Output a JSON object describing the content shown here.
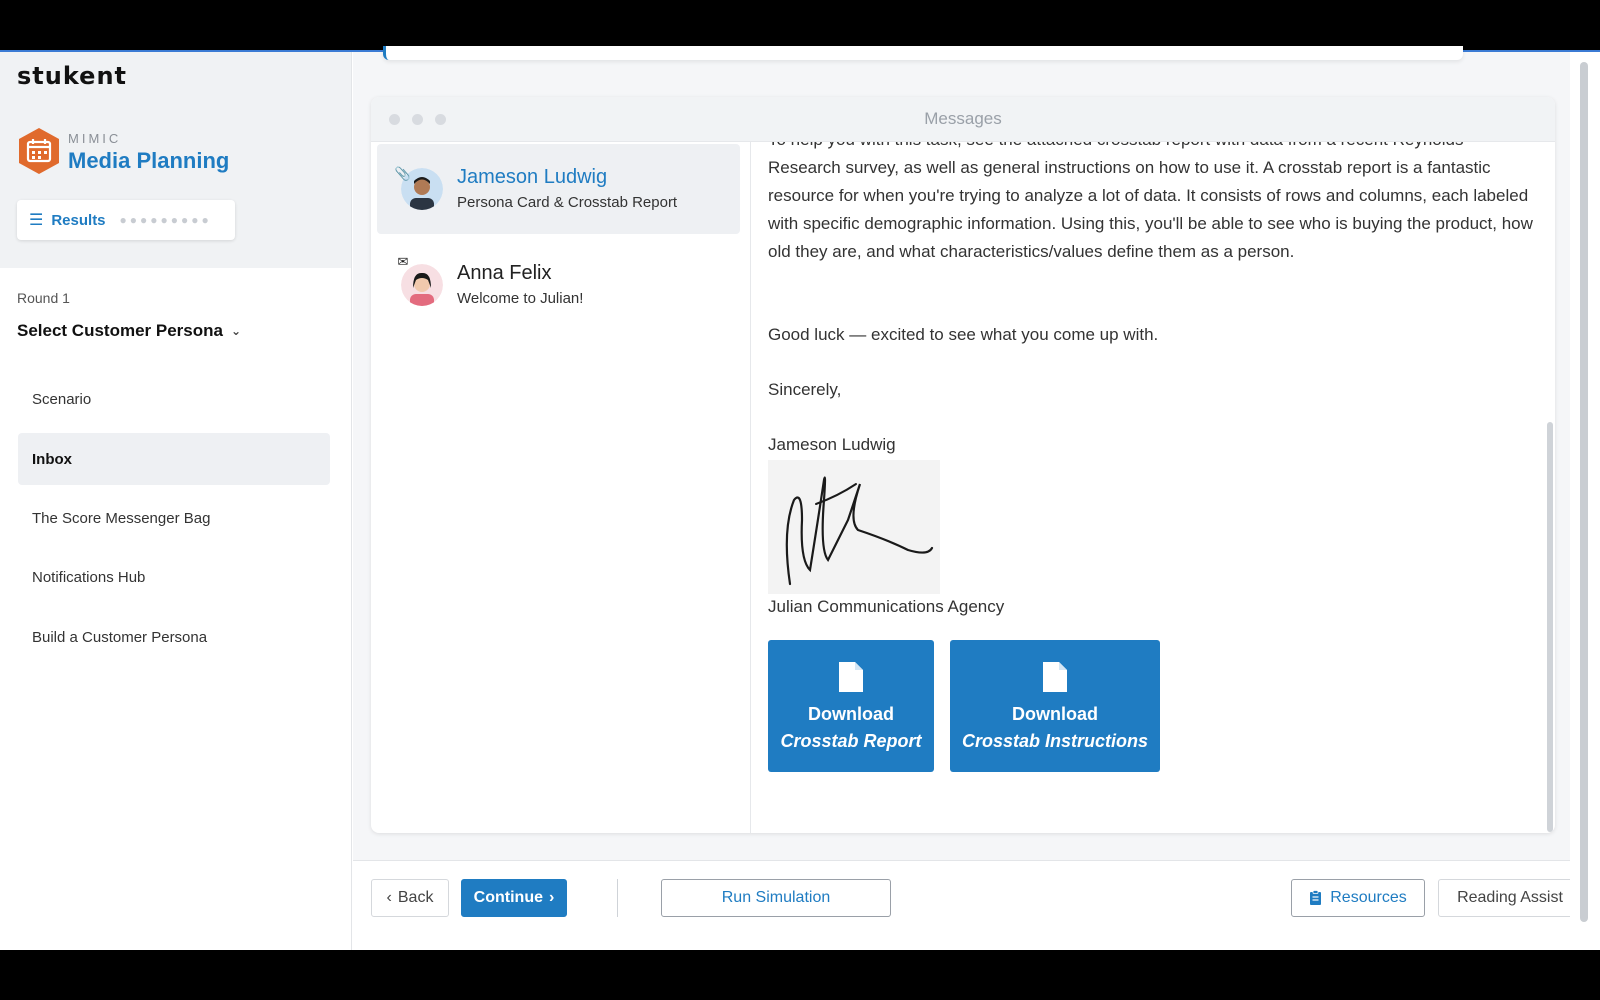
{
  "brand": {
    "logo": "stukent",
    "app_sub": "MIMIC",
    "app_title": "Media Planning"
  },
  "sidebar": {
    "results_label": "Results",
    "round_label": "Round 1",
    "section_title": "Select Customer Persona",
    "items": [
      {
        "label": "Scenario",
        "active": false
      },
      {
        "label": "Inbox",
        "active": true
      },
      {
        "label": "The Score Messenger Bag",
        "active": false
      },
      {
        "label": "Notifications Hub",
        "active": false
      },
      {
        "label": "Build a Customer Persona",
        "active": false
      }
    ]
  },
  "messages": {
    "window_title": "Messages",
    "list": [
      {
        "sender": "Jameson Ludwig",
        "subject": "Persona Card & Crosstab Report",
        "badge_icon": "paperclip-icon",
        "selected": true
      },
      {
        "sender": "Anna Felix",
        "subject": "Welcome to Julian!",
        "badge_icon": "envelope-icon",
        "selected": false
      }
    ],
    "body": {
      "partial_line": "To help you with this task, see the attached crosstab report with data from a recent Reynolds",
      "paragraph": "Research survey, as well as general instructions on how to use it. A crosstab report is a fantastic resource for when you're trying to analyze a lot of data. It consists of rows and columns, each labeled with specific demographic information. Using this, you'll be able to see who is buying the product, how old they are, and what characteristics/values define them as a person.",
      "closing_line": "Good luck — excited to see what you come up with.",
      "salutation": "Sincerely,",
      "signer": "Jameson Ludwig",
      "agency": "Julian Communications Agency"
    },
    "downloads": [
      {
        "line1": "Download",
        "line2": "Crosstab Report"
      },
      {
        "line1": "Download",
        "line2": "Crosstab Instructions"
      }
    ]
  },
  "footer": {
    "back_label": "Back",
    "continue_label": "Continue",
    "run_label": "Run Simulation",
    "resources_label": "Resources",
    "reading_label": "Reading Assist"
  },
  "colors": {
    "accent": "#1f7cc2",
    "badge": "#e06a2c"
  }
}
